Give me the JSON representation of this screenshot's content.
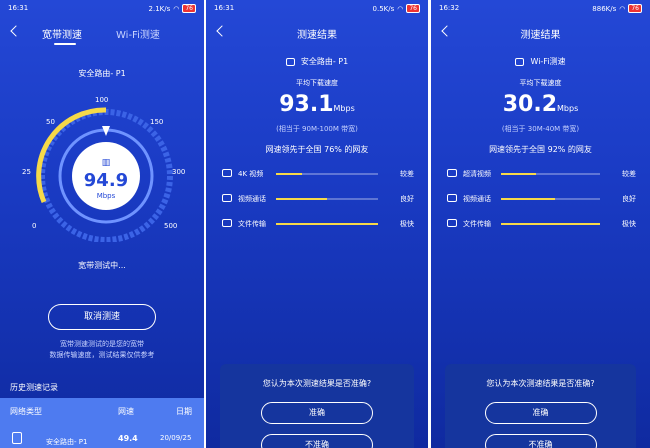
{
  "panel1": {
    "status": {
      "time": "16:31",
      "net": "2.1K/s",
      "battery": "76"
    },
    "tabs": [
      {
        "label": "宽带测速",
        "active": true
      },
      {
        "label": "Wi-Fi测速",
        "active": false
      }
    ],
    "device": "安全路由- P1",
    "gauge": {
      "ticks": [
        "0",
        "25",
        "50",
        "100",
        "150",
        "300",
        "500"
      ],
      "value": "94.9",
      "unit": "Mbps"
    },
    "progress_text": "宽带测试中...",
    "cancel_label": "取消测速",
    "note_line1": "宽带测速测试的是您的宽带",
    "note_line2": "数据传输速度，测试结果仅供参考",
    "history_title": "历史测速记录",
    "history_headers": [
      "网络类型",
      "网速",
      "日期"
    ],
    "history_row": {
      "name": "安全路由- P1",
      "speed": "49.4",
      "date": "20/09/25"
    }
  },
  "panel2": {
    "status": {
      "time": "16:31",
      "net": "0.5K/s",
      "battery": "76"
    },
    "title": "测速结果",
    "device": "安全路由- P1",
    "avg_label": "平均下载速度",
    "speed": "93.1",
    "unit": "Mbps",
    "equivalent": "(相当于 90M-100M 带宽)",
    "lead": "网速领先于全国 76% 的网友",
    "metrics": [
      {
        "label": "4K 视频",
        "grade": "较差",
        "level": 0.25
      },
      {
        "label": "视频通话",
        "grade": "良好",
        "level": 0.5
      },
      {
        "label": "文件传输",
        "grade": "极快",
        "level": 1.0
      }
    ],
    "question": "您认为本次测速结果是否准确?",
    "accurate": "准确",
    "inaccurate": "不准确"
  },
  "panel3": {
    "status": {
      "time": "16:32",
      "net": "886K/s",
      "battery": "76"
    },
    "title": "测速结果",
    "device": "Wi-Fi测速",
    "avg_label": "平均下载速度",
    "speed": "30.2",
    "unit": "Mbps",
    "equivalent": "(相当于 30M-40M 带宽)",
    "lead": "网速领先于全国 92% 的网友",
    "metrics": [
      {
        "label": "超清视频",
        "grade": "较差",
        "level": 0.35
      },
      {
        "label": "视频通话",
        "grade": "良好",
        "level": 0.55
      },
      {
        "label": "文件传输",
        "grade": "极快",
        "level": 1.0
      }
    ],
    "question": "您认为本次测速结果是否准确?",
    "accurate": "准确",
    "inaccurate": "不准确"
  },
  "colors": {
    "accent": "#f6d949",
    "bg_top": "#2448d6",
    "card": "#15359e"
  }
}
